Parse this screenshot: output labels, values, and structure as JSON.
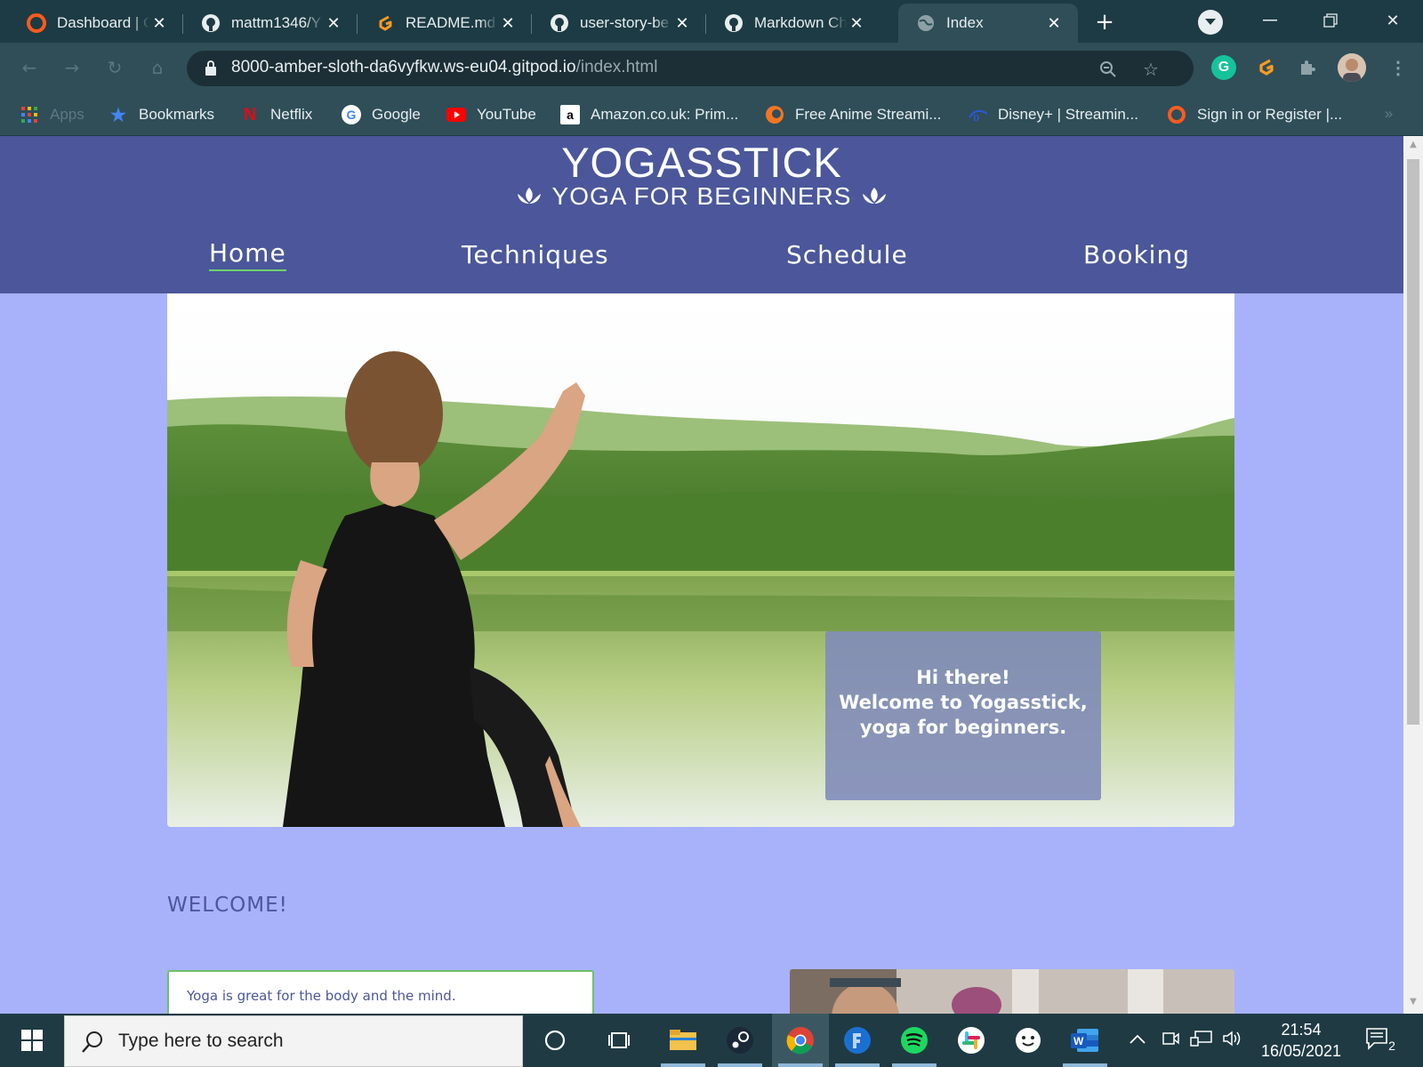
{
  "browser": {
    "tabs": [
      {
        "title": "Dashboard | C",
        "icon": "orange-circle-icon"
      },
      {
        "title": "mattm1346/Y",
        "icon": "github-icon"
      },
      {
        "title": "README.md",
        "icon": "gitpod-icon"
      },
      {
        "title": "user-story-be",
        "icon": "github-icon"
      },
      {
        "title": "Markdown Ch",
        "icon": "github-icon"
      },
      {
        "title": "Index",
        "icon": "globe-icon",
        "active": true
      }
    ],
    "url_host": "8000-amber-sloth-da6vyfkw.ws-eu04.gitpod.io",
    "url_path": "/index.html",
    "bookmarks": [
      {
        "label": "Apps",
        "icon": "apps-grid-icon"
      },
      {
        "label": "Bookmarks",
        "icon": "star-icon"
      },
      {
        "label": "Netflix",
        "icon": "netflix-icon"
      },
      {
        "label": "Google",
        "icon": "google-icon"
      },
      {
        "label": "YouTube",
        "icon": "youtube-icon"
      },
      {
        "label": "Amazon.co.uk: Prim...",
        "icon": "amazon-icon"
      },
      {
        "label": "Free Anime Streami...",
        "icon": "crunchyroll-icon"
      },
      {
        "label": "Disney+ | Streamin...",
        "icon": "disney-icon"
      },
      {
        "label": "Sign in or Register |...",
        "icon": "orange-ring-icon"
      }
    ]
  },
  "site": {
    "brand": "YOGASSTICK",
    "tagline": "YOGA FOR BEGINNERS",
    "nav": [
      {
        "label": "Home",
        "active": true
      },
      {
        "label": "Techniques"
      },
      {
        "label": "Schedule"
      },
      {
        "label": "Booking"
      }
    ],
    "hero": {
      "line1": "Hi there!",
      "line2": "Welcome to Yogasstick,",
      "line3": "yoga for beginners."
    },
    "welcome_title": "WELCOME!",
    "intro_text": "Yoga is great for the body and the mind."
  },
  "taskbar": {
    "search_placeholder": "Type here to search",
    "time": "21:54",
    "date": "16/05/2021",
    "notification_count": "2"
  },
  "colors": {
    "header_bg": "#4b579a",
    "page_bg": "#a8b2fb",
    "nav_active_underline": "#6fd26f"
  }
}
